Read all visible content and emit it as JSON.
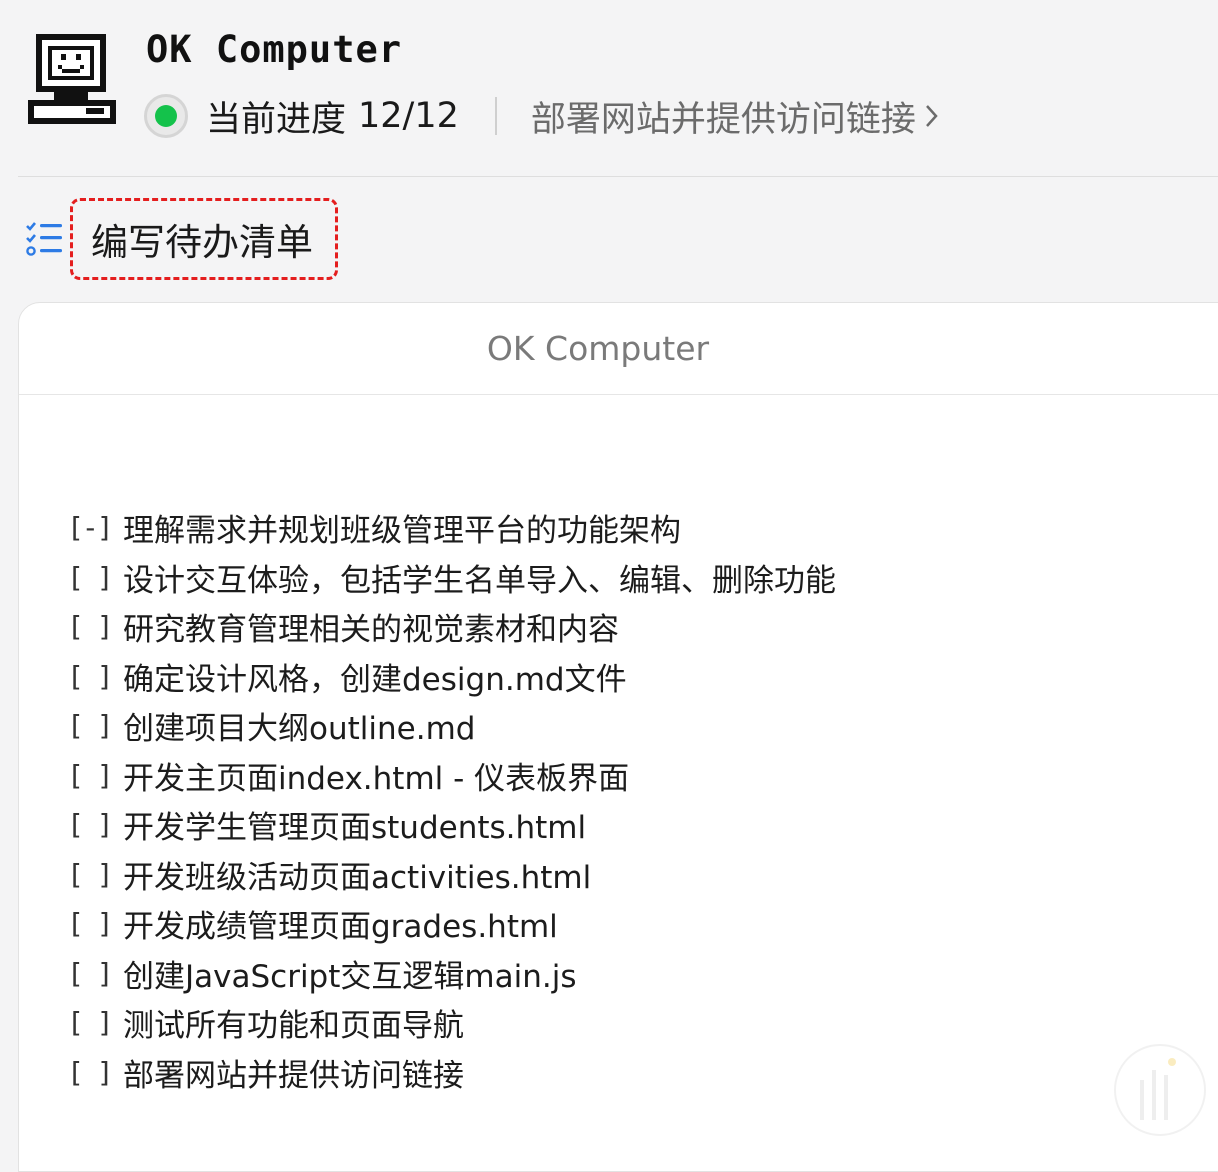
{
  "header": {
    "app_title": "OK Computer",
    "progress_label": "当前进度",
    "progress_value": "12/12",
    "current_step": "部署网站并提供访问链接",
    "status_color": "#14c24b"
  },
  "todo_section": {
    "heading": "编写待办清单",
    "highlight_color": "#e41e1e"
  },
  "panel": {
    "title": "OK Computer",
    "items": [
      {
        "mark": "[-]",
        "text": "理解需求并规划班级管理平台的功能架构"
      },
      {
        "mark": "[ ]",
        "text": "设计交互体验，包括学生名单导入、编辑、删除功能"
      },
      {
        "mark": "[ ]",
        "text": "研究教育管理相关的视觉素材和内容"
      },
      {
        "mark": "[ ]",
        "text": "确定设计风格，创建design.md文件"
      },
      {
        "mark": "[ ]",
        "text": "创建项目大纲outline.md"
      },
      {
        "mark": "[ ]",
        "text": "开发主页面index.html - 仪表板界面"
      },
      {
        "mark": "[ ]",
        "text": "开发学生管理页面students.html"
      },
      {
        "mark": "[ ]",
        "text": "开发班级活动页面activities.html"
      },
      {
        "mark": "[ ]",
        "text": "开发成绩管理页面grades.html"
      },
      {
        "mark": "[ ]",
        "text": "创建JavaScript交互逻辑main.js"
      },
      {
        "mark": "[ ]",
        "text": "测试所有功能和页面导航"
      },
      {
        "mark": "[ ]",
        "text": "部署网站并提供访问链接"
      }
    ]
  },
  "icons": {
    "logo": "retro-computer-icon",
    "status": "status-dot-icon",
    "chevron": "chevron-right-icon",
    "todo": "checklist-icon"
  }
}
